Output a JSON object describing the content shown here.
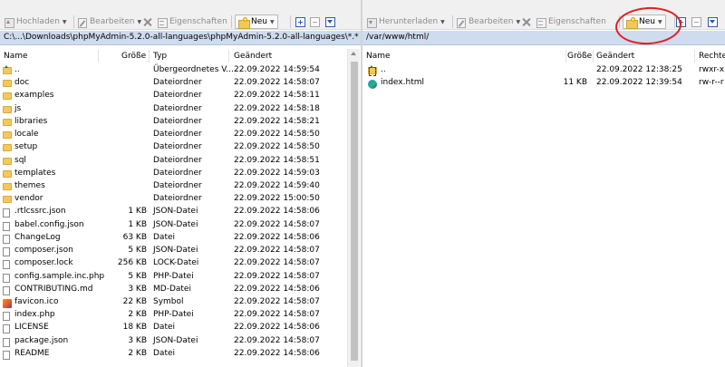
{
  "left_toolbar": {
    "upload_label": "Hochladen",
    "edit_label": "Bearbeiten",
    "properties_label": "Eigenschaften",
    "new_label": "Neu"
  },
  "right_toolbar": {
    "download_label": "Herunterladen",
    "edit_label": "Bearbeiten",
    "properties_label": "Eigenschaften",
    "new_label": "Neu"
  },
  "left_panel": {
    "path": "C:\\...\\Downloads\\phpMyAdmin-5.2.0-all-languages\\phpMyAdmin-5.2.0-all-languages\\*.*",
    "columns": {
      "name": "Name",
      "size": "Größe",
      "type": "Typ",
      "modified": "Geändert"
    },
    "rows": [
      {
        "icon": "updir",
        "name": "..",
        "size": "",
        "type": "Übergeordnetes V...",
        "modified": "22.09.2022  14:59:54"
      },
      {
        "icon": "folder",
        "name": "doc",
        "size": "",
        "type": "Dateiordner",
        "modified": "22.09.2022  14:58:07"
      },
      {
        "icon": "folder",
        "name": "examples",
        "size": "",
        "type": "Dateiordner",
        "modified": "22.09.2022  14:58:11"
      },
      {
        "icon": "folder",
        "name": "js",
        "size": "",
        "type": "Dateiordner",
        "modified": "22.09.2022  14:58:18"
      },
      {
        "icon": "folder",
        "name": "libraries",
        "size": "",
        "type": "Dateiordner",
        "modified": "22.09.2022  14:58:21"
      },
      {
        "icon": "folder",
        "name": "locale",
        "size": "",
        "type": "Dateiordner",
        "modified": "22.09.2022  14:58:50"
      },
      {
        "icon": "folder",
        "name": "setup",
        "size": "",
        "type": "Dateiordner",
        "modified": "22.09.2022  14:58:50"
      },
      {
        "icon": "folder",
        "name": "sql",
        "size": "",
        "type": "Dateiordner",
        "modified": "22.09.2022  14:58:51"
      },
      {
        "icon": "folder",
        "name": "templates",
        "size": "",
        "type": "Dateiordner",
        "modified": "22.09.2022  14:59:03"
      },
      {
        "icon": "folder",
        "name": "themes",
        "size": "",
        "type": "Dateiordner",
        "modified": "22.09.2022  14:59:40"
      },
      {
        "icon": "folder",
        "name": "vendor",
        "size": "",
        "type": "Dateiordner",
        "modified": "22.09.2022  15:00:50"
      },
      {
        "icon": "file",
        "name": ".rtlcssrc.json",
        "size": "1 KB",
        "type": "JSON-Datei",
        "modified": "22.09.2022  14:58:06"
      },
      {
        "icon": "file",
        "name": "babel.config.json",
        "size": "1 KB",
        "type": "JSON-Datei",
        "modified": "22.09.2022  14:58:07"
      },
      {
        "icon": "file",
        "name": "ChangeLog",
        "size": "63 KB",
        "type": "Datei",
        "modified": "22.09.2022  14:58:06"
      },
      {
        "icon": "file",
        "name": "composer.json",
        "size": "5 KB",
        "type": "JSON-Datei",
        "modified": "22.09.2022  14:58:07"
      },
      {
        "icon": "file",
        "name": "composer.lock",
        "size": "256 KB",
        "type": "LOCK-Datei",
        "modified": "22.09.2022  14:58:07"
      },
      {
        "icon": "file",
        "name": "config.sample.inc.php",
        "size": "5 KB",
        "type": "PHP-Datei",
        "modified": "22.09.2022  14:58:07"
      },
      {
        "icon": "file",
        "name": "CONTRIBUTING.md",
        "size": "3 KB",
        "type": "MD-Datei",
        "modified": "22.09.2022  14:58:06"
      },
      {
        "icon": "ico",
        "name": "favicon.ico",
        "size": "22 KB",
        "type": "Symbol",
        "modified": "22.09.2022  14:58:07"
      },
      {
        "icon": "file",
        "name": "index.php",
        "size": "2 KB",
        "type": "PHP-Datei",
        "modified": "22.09.2022  14:58:07"
      },
      {
        "icon": "file",
        "name": "LICENSE",
        "size": "18 KB",
        "type": "Datei",
        "modified": "22.09.2022  14:58:06"
      },
      {
        "icon": "file",
        "name": "package.json",
        "size": "3 KB",
        "type": "JSON-Datei",
        "modified": "22.09.2022  14:58:07"
      },
      {
        "icon": "file",
        "name": "README",
        "size": "2 KB",
        "type": "Datei",
        "modified": "22.09.2022  14:58:06"
      }
    ]
  },
  "right_panel": {
    "path": "/var/www/html/",
    "columns": {
      "name": "Name",
      "size": "Größe",
      "modified": "Geändert",
      "rights": "Rechte"
    },
    "rows": [
      {
        "icon": "updir",
        "name": "..",
        "size": "",
        "modified": "22.09.2022 12:38:25",
        "rights": "rwxr-xr"
      },
      {
        "icon": "edge",
        "name": "index.html",
        "size": "11 KB",
        "modified": "22.09.2022 12:39:54",
        "rights": "rw-r--r"
      }
    ]
  }
}
